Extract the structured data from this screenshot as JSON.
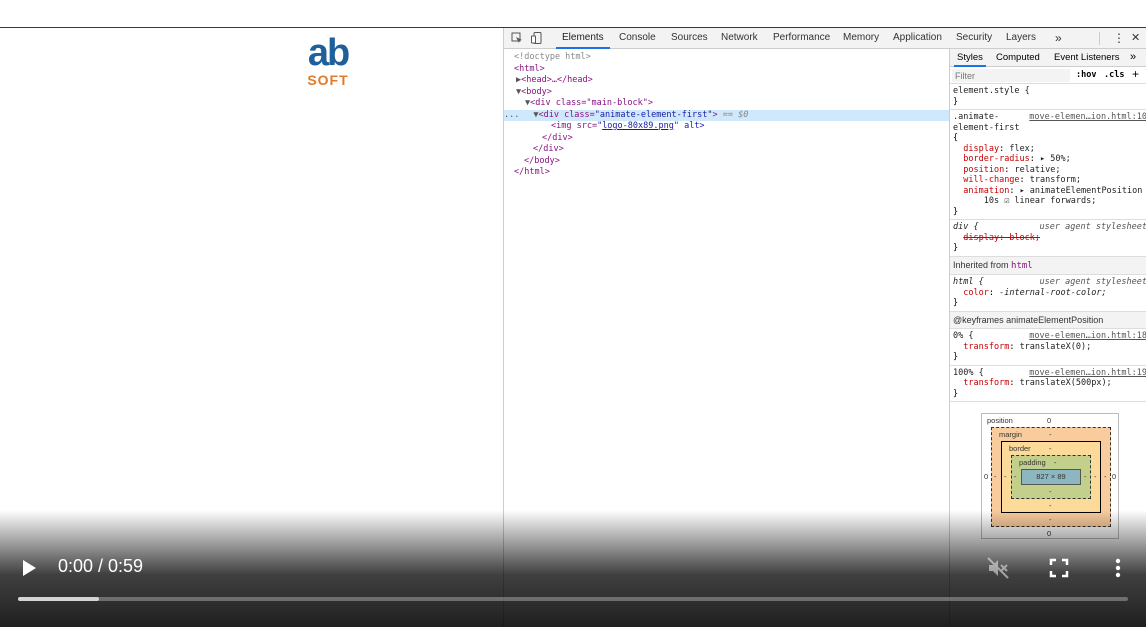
{
  "logo": {
    "top": "ab",
    "bottom": "SOFT"
  },
  "devtools": {
    "tabs": [
      "Elements",
      "Console",
      "Sources",
      "Network",
      "Performance",
      "Memory",
      "Application",
      "Security",
      "Layers"
    ],
    "more": "»",
    "menu": "⋮",
    "close": "✕",
    "dom": {
      "doctype": "<!doctype html>",
      "html_open": "<html>",
      "head": "<head>…</head>",
      "body_open": "<body>",
      "div_main": "<div class=\"main-block\">",
      "div_anim_tag": "<div class=",
      "div_anim_cls": "\"animate-element-first\"",
      "div_anim_close": ">",
      "div_anim_eq": " == $0",
      "dots": "...",
      "img_tag": "<img src=",
      "img_src": "logo-80x89.png",
      "img_alt": "\" alt>",
      "div_close1": "</div>",
      "div_close2": "</div>",
      "body_close": "</body>",
      "html_close": "</html>"
    },
    "styles": {
      "tabs": [
        "Styles",
        "Computed",
        "Event Listeners"
      ],
      "more": "»",
      "filter_placeholder": "Filter",
      "hov": ":hov",
      "cls": ".cls",
      "plus": "+",
      "element_style": "element.style {",
      "close_brace": "}",
      "rule1": {
        "selector_line1": ".animate-",
        "selector_line2": "element-first",
        "source": "move-elemen…ion.html:10",
        "open": "{",
        "props": [
          {
            "name": "display",
            "value": "flex;"
          },
          {
            "name": "border-radius",
            "value": "▸ 50%;"
          },
          {
            "name": "position",
            "value": "relative;"
          },
          {
            "name": "will-change",
            "value": "transform;"
          },
          {
            "name": "animation",
            "value": "▸ animateElementPosition"
          }
        ],
        "anim_cont": "10s ☑ linear forwards;"
      },
      "rule2": {
        "selector": "div {",
        "ua": "user agent stylesheet",
        "prop": "display: block;"
      },
      "inherited": {
        "label": "Inherited from",
        "tag": "html"
      },
      "rule3": {
        "selector": "html {",
        "ua": "user agent stylesheet",
        "prop": "color",
        "value": "-internal-root-color;"
      },
      "keyframes": "@keyframes animateElementPosition",
      "kf0": {
        "selector": "0% {",
        "source": "move-elemen…ion.html:18",
        "prop": "transform",
        "value": "translateX(0);"
      },
      "kf100": {
        "selector": "100% {",
        "source": "move-elemen…ion.html:19",
        "prop": "transform",
        "value": "translateX(500px);"
      }
    },
    "boxmodel": {
      "position_label": "position",
      "position_val": "0",
      "margin_label": "margin",
      "margin_val": "-",
      "border_label": "border",
      "border_val": "-",
      "padding_label": "padding",
      "padding_val": "-",
      "content": "827 × 89",
      "left_outer": "0",
      "left_margin": "-",
      "left_border": "-",
      "left_padding": "-",
      "right_padding": "-",
      "right_border": "-",
      "right_margin": "-",
      "right_outer": "0",
      "bottom_padding": "-",
      "bottom_border": "-",
      "bottom_margin": "-",
      "bottom_outer": "0"
    }
  },
  "video": {
    "time": "0:00 / 0:59",
    "progress_fraction": 0.073
  }
}
